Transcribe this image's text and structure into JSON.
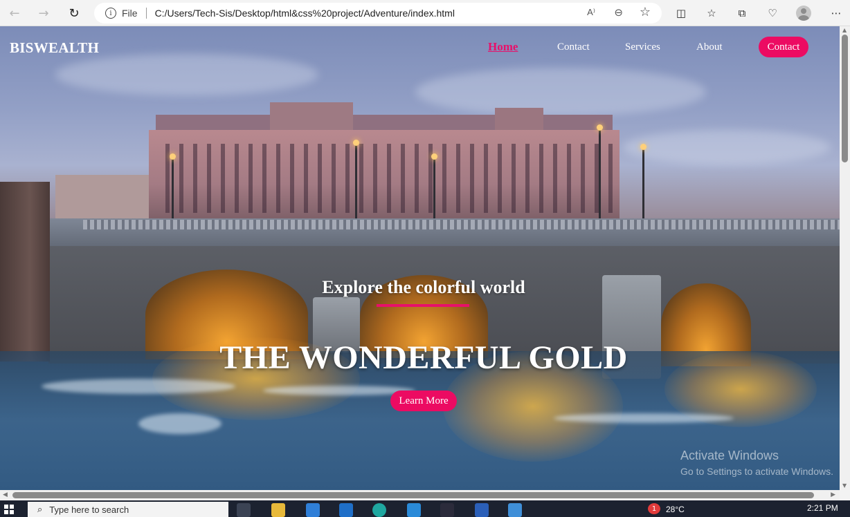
{
  "browser": {
    "file_label": "File",
    "url": "C:/Users/Tech-Sis/Desktop/html&css%20project/Adventure/index.html",
    "read_aloud_label": "A⁾"
  },
  "site": {
    "logo": "BISWEALTH",
    "nav": [
      "Home",
      "Contact",
      "Services",
      "About"
    ],
    "contact_button": "Contact"
  },
  "hero": {
    "subtitle": "Explore the colorful world",
    "title": "THE WONDERFUL GOLD",
    "cta": "Learn More",
    "accent_color": "#ec0b62"
  },
  "watermark": {
    "line1": "Activate Windows",
    "line2": "Go to Settings to activate Windows."
  },
  "taskbar": {
    "search_placeholder": "Type here to search",
    "temperature": "28°C",
    "time": "2:21 PM",
    "notification_count": "1"
  }
}
